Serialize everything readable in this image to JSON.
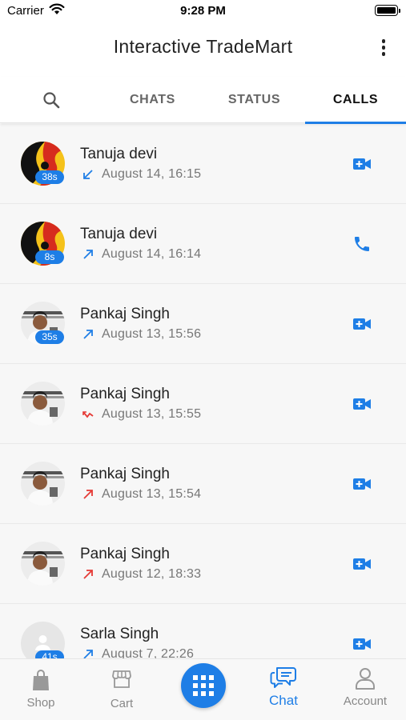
{
  "status_bar": {
    "carrier": "Carrier",
    "time": "9:28 PM"
  },
  "header": {
    "title": "Interactive TradeMart"
  },
  "tabs": [
    {
      "label": "",
      "icon": "search-icon"
    },
    {
      "label": "CHATS"
    },
    {
      "label": "STATUS"
    },
    {
      "label": "CALLS",
      "active": true
    }
  ],
  "calls": [
    {
      "name": "Tanuja devi",
      "time": "August 14, 16:15",
      "duration": "38s",
      "direction": "incoming",
      "type": "video",
      "avatar": "tanuja"
    },
    {
      "name": "Tanuja devi",
      "time": "August 14, 16:14",
      "duration": "8s",
      "direction": "outgoing",
      "type": "voice",
      "avatar": "tanuja"
    },
    {
      "name": "Pankaj Singh",
      "time": "August 13, 15:56",
      "duration": "35s",
      "direction": "outgoing",
      "type": "video",
      "avatar": "pankaj"
    },
    {
      "name": "Pankaj Singh",
      "time": "August 13, 15:55",
      "duration": "",
      "direction": "missed",
      "type": "video",
      "avatar": "pankaj"
    },
    {
      "name": "Pankaj Singh",
      "time": "August 13, 15:54",
      "duration": "",
      "direction": "outgoing-missed",
      "type": "video",
      "avatar": "pankaj"
    },
    {
      "name": "Pankaj Singh",
      "time": "August 12, 18:33",
      "duration": "",
      "direction": "outgoing-missed",
      "type": "video",
      "avatar": "pankaj"
    },
    {
      "name": "Sarla Singh",
      "time": "August 7, 22:26",
      "duration": "41s",
      "direction": "outgoing",
      "type": "video",
      "avatar": "placeholder"
    }
  ],
  "bottom_nav": {
    "shop": "Shop",
    "cart": "Cart",
    "chat": "Chat",
    "account": "Account"
  },
  "colors": {
    "accent": "#1e7ee6",
    "missed": "#e53935",
    "text": "#222222",
    "muted": "#777777"
  }
}
